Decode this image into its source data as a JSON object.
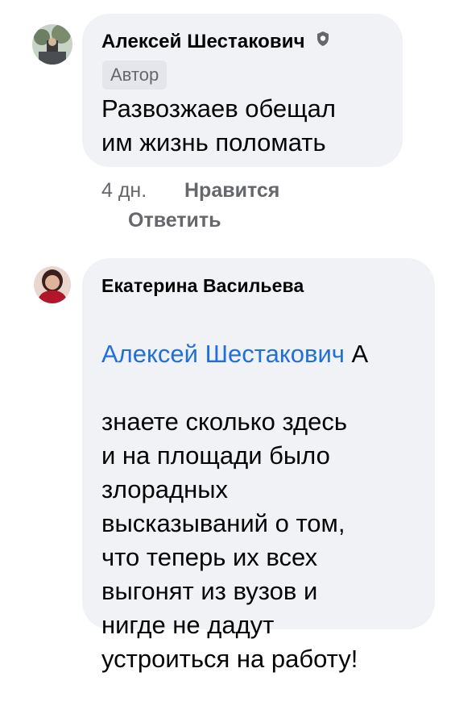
{
  "comments": [
    {
      "author": "Алексей Шестакович",
      "author_chip": "Автор",
      "text": "Развозжаев обещал\nим жизнь поломать",
      "time": "4 дн.",
      "like_label": "Нравится",
      "reply_label": "Ответить"
    },
    {
      "author": "Екатерина Васильева",
      "mention": "Алексей Шестакович",
      "text_first": " А",
      "text": "знаете сколько здесь\nи на площади было\nзлорадных\nвысказываний о том,\nчто теперь их всех\nвыгонят из вузов и\nнигде не дадут\nустроиться на работу!"
    }
  ],
  "colors": {
    "bubble": "#f0f2f5",
    "mention": "#216fdb",
    "meta": "#65676b",
    "chip": "#e4e6eb"
  },
  "icons": [
    "shield-badge-icon"
  ]
}
